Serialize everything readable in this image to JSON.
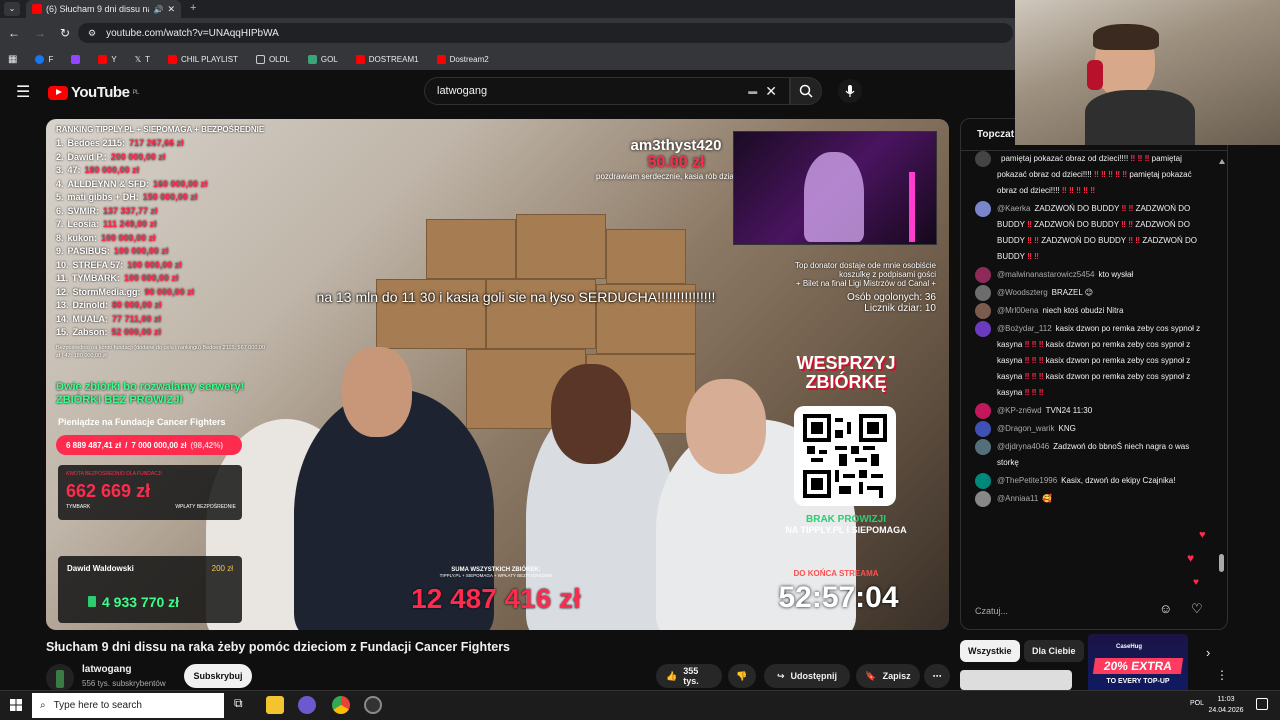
{
  "browser": {
    "tab_title": "(6) Słucham 9 dni dissu na raka",
    "url": "youtube.com/watch?v=UNAqqHIPbWA",
    "bookmarks": [
      "F",
      "Y",
      "T",
      "CHIL PLAYLIST",
      "OLDL",
      "GOL",
      "DOSTREAM1",
      "Dostream2"
    ]
  },
  "youtube": {
    "logo_text": "YouTube",
    "logo_region": "PL",
    "search_value": "latwogang"
  },
  "video": {
    "ranking_title": "RANKING TIPPLY.PL + SIEPOMAGA + BEZPOŚREDNIE",
    "ranking": [
      {
        "rank": "1.",
        "name": "Bedoes 2115:",
        "amount": "717 267,66 zł"
      },
      {
        "rank": "2.",
        "name": "Dawid P.:",
        "amount": "200 000,00 zł"
      },
      {
        "rank": "3.",
        "name": "47:",
        "amount": "180 000,00 zł"
      },
      {
        "rank": "4.",
        "name": "ALLDEYNN & SFD:",
        "amount": "160 000,00 zł"
      },
      {
        "rank": "5.",
        "name": "mati gibbs + DH:",
        "amount": "150 000,00 zł"
      },
      {
        "rank": "6.",
        "name": "SVMIR:",
        "amount": "137 337,77 zł"
      },
      {
        "rank": "7.",
        "name": "Leosia:",
        "amount": "111 249,00 zł"
      },
      {
        "rank": "8.",
        "name": "kukon:",
        "amount": "100 000,00 zł"
      },
      {
        "rank": "9.",
        "name": "PASIBUS:",
        "amount": "100 000,00 zł"
      },
      {
        "rank": "10.",
        "name": "STREFA 57:",
        "amount": "100 000,00 zł"
      },
      {
        "rank": "11.",
        "name": "TYMBARK:",
        "amount": "100 000,00 zł"
      },
      {
        "rank": "12.",
        "name": "StormMedia.gg:",
        "amount": "90 000,00 zł"
      },
      {
        "rank": "13.",
        "name": "Dzinold:",
        "amount": "80 000,00 zł"
      },
      {
        "rank": "14.",
        "name": "MUALA:",
        "amount": "77 711,00 zł"
      },
      {
        "rank": "15.",
        "name": "Zabson:",
        "amount": "52 000,00 zł"
      }
    ],
    "ranking_note": "Bezpośrednio na konto fundacji (dodane do celu i rankingu) Bedoes 2115: 567 000,00 zł | 47: 180 000,00 zł",
    "green_banner_1": "Dwie zbiórki bo rozwalamy serwery!",
    "green_banner_2": "ZBIÓRKI BEZ PROWIZJI",
    "fund_label": "Pieniądze na Fundacje Cancer Fighters",
    "fund_current": "6 889 487,41 zł",
    "fund_goal": "7 000 000,00 zł",
    "fund_pct": "(98,42%)",
    "fund_progress": 0.9842,
    "panel_label": "KWOTA BEZPOŚREDNIO DLA FUNDACJI",
    "panel_value": "662 669 zł",
    "panel_left": "TYMBARK",
    "panel_right": "WPŁATY BEZPOŚREDNIE",
    "dawid_name": "Dawid Waldowski",
    "dawid_amount": "200 zł",
    "dawid_big": "4 933 770 zł",
    "donor_name": "am3thyst420",
    "donor_amount": "50.00 zł",
    "donor_msg": "pozdrawiam serdecznie, kasia rób dziarke",
    "overlay_text": "na 13 mln do 11 30 i kasia goli sie na łyso SERDUCHA!!!!!!!!!!!!!!!",
    "info_1": "Top donator dostaje ode mnie osobiście koszulkę z podpisami gości",
    "info_2": "+ Bilet na finał Ligi Mistrzów od Canal +",
    "guests": "Osób ogolonych: 36",
    "tattoos": "Licznik dziar: 10",
    "support_1": "WESPRZYJ",
    "support_2": "ZBIÓRKĘ",
    "no_fee_1": "BRAK PROWIZJI",
    "no_fee_2": "NA TIPPLY.PL I SIEPOMAGA",
    "sum_label": "SUMA WSZYSTKICH ZBIÓREK:",
    "sum_sub": "TIPPLY.PL + SIEPOMAGA + WPŁATY BEZPOŚREDNIE",
    "sum_value": "12 487 416 zł",
    "end_label": "DO KOŃCA STREAMA",
    "timer": "52:57:04"
  },
  "meta": {
    "title": "Słucham 9 dni dissu na raka żeby pomóc dzieciom z Fundacji Cancer Fighters",
    "channel": "latwogang",
    "subscribers": "556 tys. subskrybentów",
    "subscribe": "Subskrybuj",
    "likes": "355 tys.",
    "share": "Udostępnij",
    "save": "Zapisz"
  },
  "chat": {
    "header": "Topczat",
    "input_placeholder": "Czatuj...",
    "messages": [
      {
        "user": "",
        "text": "pamiętaj pokazać obraz od dzieci!!!! ‼ ‼ ‼ pamiętaj pokazać obraz od dzieci!!!! ‼ ‼ ‼ ‼ ‼ pamiętaj pokazać obraz od dzieci!!!! ‼ ‼ ‼ ‼ ‼",
        "color": "#444"
      },
      {
        "user": "@Kaerka",
        "text": "ZADZWOŃ DO BUDDY ‼ ‼ ZADZWOŃ DO BUDDY ‼ ZADZWOŃ DO BUDDY ‼ ‼ ZADZWOŃ DO BUDDY ‼ ‼ ZADZWOŃ DO BUDDY ‼ ‼ ZADZWOŃ DO BUDDY ‼ ‼",
        "color": "#7986cb"
      },
      {
        "user": "@malwinanastarowicz5454",
        "text": "kto wysłał",
        "color": "#8e2a5a"
      },
      {
        "user": "@Woodszterg",
        "text": "BRAZEL 😉",
        "color": "#6d6d6d"
      },
      {
        "user": "@Mrl00ena",
        "text": "niech ktoś obudzi Nitra",
        "color": "#7a5c4f"
      },
      {
        "user": "@Bożydar_112",
        "text": "kasix dzwon po remka zeby cos sypnoł z kasyna ‼ ‼ ‼ kasix dzwon po remka zeby cos sypnoł z kasyna ‼ ‼ ‼ kasix dzwon po remka zeby cos sypnoł z kasyna ‼ ‼ ‼ kasix dzwon po remka zeby cos sypnoł z kasyna ‼ ‼ ‼",
        "color": "#6a3bbf"
      },
      {
        "user": "@KP-zn6wd",
        "text": "TVN24 11:30",
        "color": "#c2185b"
      },
      {
        "user": "@Dragon_warik",
        "text": "KNG",
        "color": "#3f51b5"
      },
      {
        "user": "@djdryna4046",
        "text": "Zadzwoń do bbnoŚ niech nagra o was storkę",
        "color": "#546e7a"
      },
      {
        "user": "@ThePetite1996",
        "text": "Kasix, dzwoń do ekipy Czajnika!",
        "color": "#00897b"
      },
      {
        "user": "@Anniaa11",
        "text": "🥰",
        "color": "#888"
      }
    ]
  },
  "chips": [
    "Wszystkie",
    "Dla Ciebie"
  ],
  "ad": {
    "brand": "CaseHug",
    "line1": "20% EXTRA",
    "line2": "TO EVERY TOP-UP"
  },
  "taskbar": {
    "search_placeholder": "Type here to search",
    "lang": "POL",
    "time": "11:03",
    "date": "24.04.2026"
  }
}
